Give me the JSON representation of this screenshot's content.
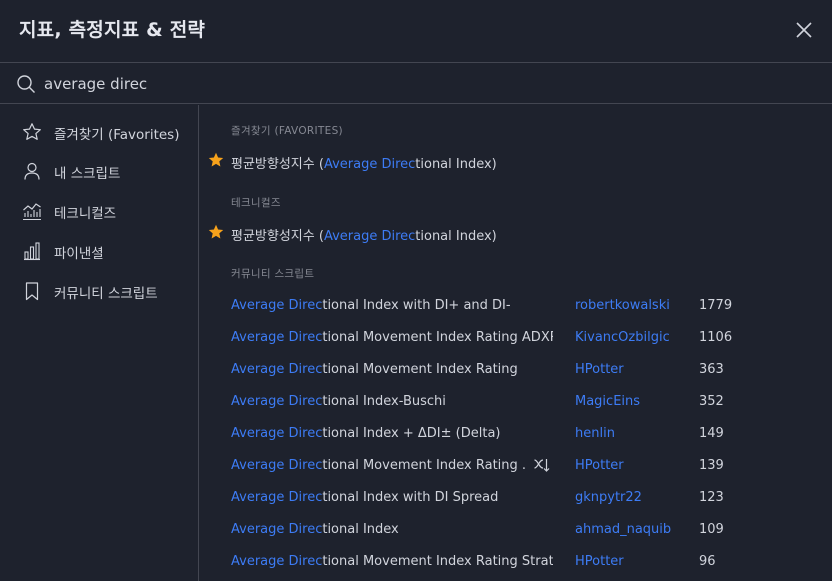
{
  "header": {
    "title": "지표, 측정지표 & 전략"
  },
  "search": {
    "value": "average direc"
  },
  "highlight": {
    "match": "Average Direc"
  },
  "sidebar": {
    "items": [
      {
        "label": "즐겨찾기 (Favorites)",
        "icon": "star-outline-icon"
      },
      {
        "label": "내 스크립트",
        "icon": "user-icon"
      },
      {
        "label": "테크니컬즈",
        "icon": "chart-icon"
      },
      {
        "label": "파이낸셜",
        "icon": "bar-chart-icon"
      },
      {
        "label": "커뮤니티 스크립트",
        "icon": "bookmark-icon"
      }
    ]
  },
  "sections": {
    "favorites": {
      "heading": "즐겨찾기 (FAVORITES)",
      "item": {
        "prefix": "평균방향성지수 (",
        "rest": "tional Index)"
      }
    },
    "technicals": {
      "heading": "테크니컬즈",
      "item": {
        "prefix": "평균방향성지수 (",
        "rest": "tional Index)"
      }
    },
    "community": {
      "heading": "커뮤니티 스크립트",
      "rows": [
        {
          "rest": "tional Index with DI+ and DI-",
          "author": "robertkowalski",
          "count": "1779",
          "strategy": false
        },
        {
          "rest": "tional Movement Index Rating ADXR...",
          "author": "KivancOzbilgic",
          "count": "1106",
          "strategy": false
        },
        {
          "rest": "tional Movement Index Rating",
          "author": "HPotter",
          "count": "363",
          "strategy": false
        },
        {
          "rest": "tional Index-Buschi",
          "author": "MagicEins",
          "count": "352",
          "strategy": false
        },
        {
          "rest": "tional Index + ΔDI± (Delta)",
          "author": "henlin",
          "count": "149",
          "strategy": false
        },
        {
          "rest": "tional Movement Index Rating ...",
          "author": "HPotter",
          "count": "139",
          "strategy": true
        },
        {
          "rest": "tional Index with DI Spread",
          "author": "gknpytr22",
          "count": "123",
          "strategy": false
        },
        {
          "rest": "tional Index",
          "author": "ahmad_naquib",
          "count": "109",
          "strategy": false
        },
        {
          "rest": "tional Movement Index Rating Strat...",
          "author": "HPotter",
          "count": "96",
          "strategy": false
        }
      ]
    }
  },
  "colors": {
    "accent": "#3d7cf5",
    "star": "#f7a21b",
    "background": "#1e222d",
    "border": "#434651"
  }
}
